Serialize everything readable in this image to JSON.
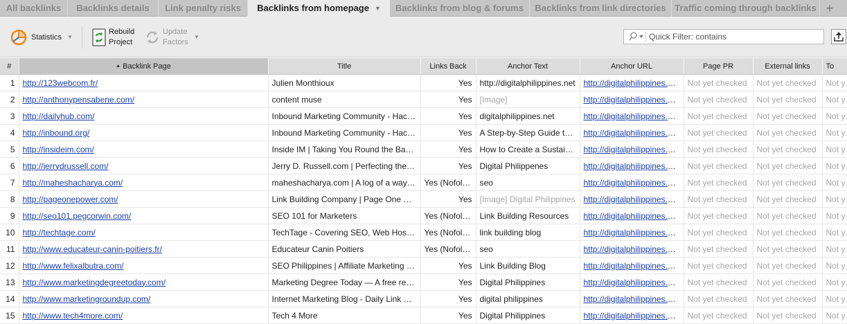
{
  "tabs": [
    {
      "label": "All backlinks",
      "active": false
    },
    {
      "label": "Backlinks details",
      "active": false
    },
    {
      "label": "Link penalty risks",
      "active": false
    },
    {
      "label": "Backlinks from homepage",
      "active": true
    },
    {
      "label": "Backlinks from blog & forums",
      "active": false
    },
    {
      "label": "Backlinks from link directories",
      "active": false
    },
    {
      "label": "Traffic coming through backlinks",
      "active": false
    }
  ],
  "add_tab_label": "+",
  "toolbar": {
    "statistics_label": "Statistics",
    "rebuild_line1": "Rebuild",
    "rebuild_line2": "Project",
    "update_line1": "Update",
    "update_line2": "Factors"
  },
  "filter": {
    "placeholder": "Quick Filter: contains",
    "value": ""
  },
  "columns": [
    "#",
    "Backlink Page",
    "Title",
    "Links Back",
    "Anchor Text",
    "Anchor URL",
    "Page PR",
    "External links",
    "To"
  ],
  "sort_indicator": "▲",
  "rows": [
    {
      "n": "1",
      "page": "http://123webcom.fr/",
      "title": "Julien Monthioux",
      "links_back": "Yes",
      "anchor_pre": "",
      "anchor": "http://digitalphilippines.net",
      "url": "http://digitalphilippines.net/",
      "pr": "Not yet checked",
      "ext": "Not yet checked",
      "to": "Not yet checked"
    },
    {
      "n": "2",
      "page": "http://anthonypensabene.com/",
      "title": "content muse",
      "links_back": "Yes",
      "anchor_pre": "[Image]",
      "anchor": "",
      "url": "http://digitalphilippines.net/",
      "pr": "Not yet checked",
      "ext": "Not yet checked",
      "to": "Not yet checked"
    },
    {
      "n": "3",
      "page": "http://dailyhub.com/",
      "title": "Inbound Marketing Community - HackerNews for Marketers",
      "links_back": "Yes",
      "anchor_pre": "",
      "anchor": "digitalphilippines.net",
      "url": "http://digitalphilippines.net/",
      "pr": "Not yet checked",
      "ext": "Not yet checked",
      "to": "Not yet checked"
    },
    {
      "n": "4",
      "page": "http://inbound.org/",
      "title": "Inbound Marketing Community - HackerNews for Marketers",
      "links_back": "Yes",
      "anchor_pre": "",
      "anchor": "A Step-by-Step Guide to Link Building",
      "url": "http://digitalphilippines.net/",
      "pr": "Not yet checked",
      "ext": "Not yet checked",
      "to": "Not yet checked"
    },
    {
      "n": "5",
      "page": "http://insideim.com/",
      "title": "Inside IM | Taking You Round the Back of Internet Marketing",
      "links_back": "Yes",
      "anchor_pre": "",
      "anchor": "How to Create a Sustainable Link Building Strategy",
      "url": "http://digitalphilippines.net/",
      "pr": "Not yet checked",
      "ext": "Not yet checked",
      "to": "Not yet checked"
    },
    {
      "n": "6",
      "page": "http://jerrydrussell.com/",
      "title": "Jerry D. Russell.com | Perfecting the Art of Internet Marketing",
      "links_back": "Yes",
      "anchor_pre": "",
      "anchor": "Digital Philippenes",
      "url": "http://digitalphilippines.net/",
      "pr": "Not yet checked",
      "ext": "Not yet checked",
      "to": "Not yet checked"
    },
    {
      "n": "7",
      "page": "http://maheshacharya.com/",
      "title": "maheshacharya.com | A log of a way to the web",
      "links_back": "Yes (Nofollow)",
      "anchor_pre": "",
      "anchor": "seo",
      "url": "http://digitalphilippines.net/",
      "pr": "Not yet checked",
      "ext": "Not yet checked",
      "to": "Not yet checked"
    },
    {
      "n": "8",
      "page": "http://pageonepower.com/",
      "title": "Link Building Company | Page One Power",
      "links_back": "Yes",
      "anchor_pre": "[Image] ",
      "anchor": "Digital Philippines",
      "url": "http://digitalphilippines.net/",
      "pr": "Not yet checked",
      "ext": "Not yet checked",
      "to": "Not yet checked"
    },
    {
      "n": "9",
      "page": "http://seo101.pegcorwin.com/",
      "title": "SEO 101 for Marketers",
      "links_back": "Yes (Nofollow)",
      "anchor_pre": "",
      "anchor": "Link Building Resources",
      "url": "http://digitalphilippines.net/",
      "pr": "Not yet checked",
      "ext": "Not yet checked",
      "to": "Not yet checked"
    },
    {
      "n": "10",
      "page": "http://techtage.com/",
      "title": "TechTage - Covering SEO, Web Hosting and Tech News",
      "links_back": "Yes (Nofollow)",
      "anchor_pre": "",
      "anchor": "link building blog",
      "url": "http://digitalphilippines.net/",
      "pr": "Not yet checked",
      "ext": "Not yet checked",
      "to": "Not yet checked"
    },
    {
      "n": "11",
      "page": "http://www.educateur-canin-poitiers.fr/",
      "title": "Educateur Canin Poitiers",
      "links_back": "Yes (Nofollow)",
      "anchor_pre": "",
      "anchor": "seo",
      "url": "http://digitalphilippines.net/",
      "pr": "Not yet checked",
      "ext": "Not yet checked",
      "to": "Not yet checked"
    },
    {
      "n": "12",
      "page": "http://www.felixalbutra.com/",
      "title": "SEO Philippines | Affiliate Marketing Philippines",
      "links_back": "Yes",
      "anchor_pre": "",
      "anchor": "Link Building Blog",
      "url": "http://digitalphilippines.net/",
      "pr": "Not yet checked",
      "ext": "Not yet checked",
      "to": "Not yet checked"
    },
    {
      "n": "13",
      "page": "http://www.marketingdegreetoday.com/",
      "title": "Marketing Degree Today — A free resource for marketing students",
      "links_back": "Yes",
      "anchor_pre": "",
      "anchor": "Digital Philippines",
      "url": "http://digitalphilippines.net/",
      "pr": "Not yet checked",
      "ext": "Not yet checked",
      "to": "Not yet checked"
    },
    {
      "n": "14",
      "page": "http://www.marketingroundup.com/",
      "title": "Internet Marketing Blog - Daily Link Roundup",
      "links_back": "Yes",
      "anchor_pre": "",
      "anchor": "digital philippines",
      "url": "http://digitalphilippines.net/",
      "pr": "Not yet checked",
      "ext": "Not yet checked",
      "to": "Not yet checked"
    },
    {
      "n": "15",
      "page": "http://www.tech4more.com/",
      "title": "Tech 4 More",
      "links_back": "Yes",
      "anchor_pre": "",
      "anchor": "Digital Philippines",
      "url": "http://digitalphilippines.net/",
      "pr": "Not yet checked",
      "ext": "Not yet checked",
      "to": "Not yet checked"
    }
  ],
  "colors": {
    "link": "#1a3fa8",
    "muted": "#a6a6a6",
    "active_tab": "#ebebeb",
    "tab_bar": "#c6c6c6",
    "statistics_icon": "#e8871e",
    "rebuild_icon": "#2e9a3a"
  }
}
